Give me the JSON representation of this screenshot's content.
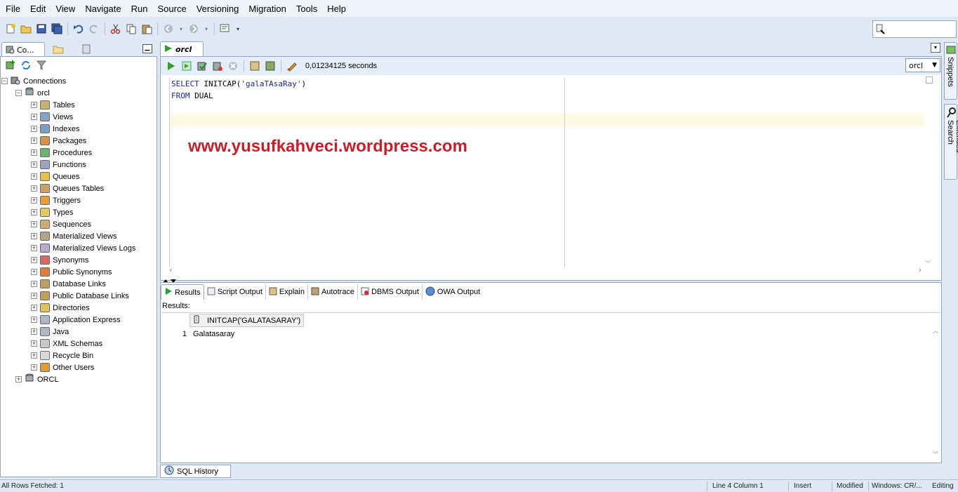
{
  "menu": [
    "File",
    "Edit",
    "View",
    "Navigate",
    "Run",
    "Source",
    "Versioning",
    "Migration",
    "Tools",
    "Help"
  ],
  "left_tabs": {
    "connections": "Co..."
  },
  "tree": {
    "root": "Connections",
    "connection": "orcl",
    "items": [
      "Tables",
      "Views",
      "Indexes",
      "Packages",
      "Procedures",
      "Functions",
      "Queues",
      "Queues Tables",
      "Triggers",
      "Types",
      "Sequences",
      "Materialized Views",
      "Materialized Views Logs",
      "Synonyms",
      "Public Synonyms",
      "Database Links",
      "Public Database Links",
      "Directories",
      "Application Express",
      "Java",
      "XML Schemas",
      "Recycle Bin",
      "Other Users"
    ],
    "second_connection": "ORCL"
  },
  "editor": {
    "tab_title": "orcl",
    "elapsed": "0,01234125 seconds",
    "connection_select": "orcl",
    "code": {
      "line1_kw": "SELECT",
      "line1_rest": " INITCAP(",
      "line1_str": "'galaTAsaRay'",
      "line1_end": ")",
      "line2_kw": "FROM",
      "line2_rest": " DUAL"
    },
    "watermark": "www.yusufkahveci.wordpress.com"
  },
  "results": {
    "tabs": [
      "Results",
      "Script Output",
      "Explain",
      "Autotrace",
      "DBMS Output",
      "OWA Output"
    ],
    "label": "Results:",
    "column": "INITCAP('GALATASARAY')",
    "rows": [
      {
        "num": "1",
        "value": "Galatasaray"
      }
    ]
  },
  "sql_history": "SQL History",
  "side_tabs": {
    "snippets": "Snippets",
    "extended_search": "Extended Search"
  },
  "status": {
    "left": "All Rows Fetched: 1",
    "position": "Line 4 Column 1",
    "mode": "Insert",
    "modified": "Modified",
    "eol": "Windows: CR/...",
    "state": "Editing"
  },
  "colors": {
    "watermark": "#c3202a",
    "keyword": "#1b2b8c",
    "run_green": "#2ea02e"
  }
}
